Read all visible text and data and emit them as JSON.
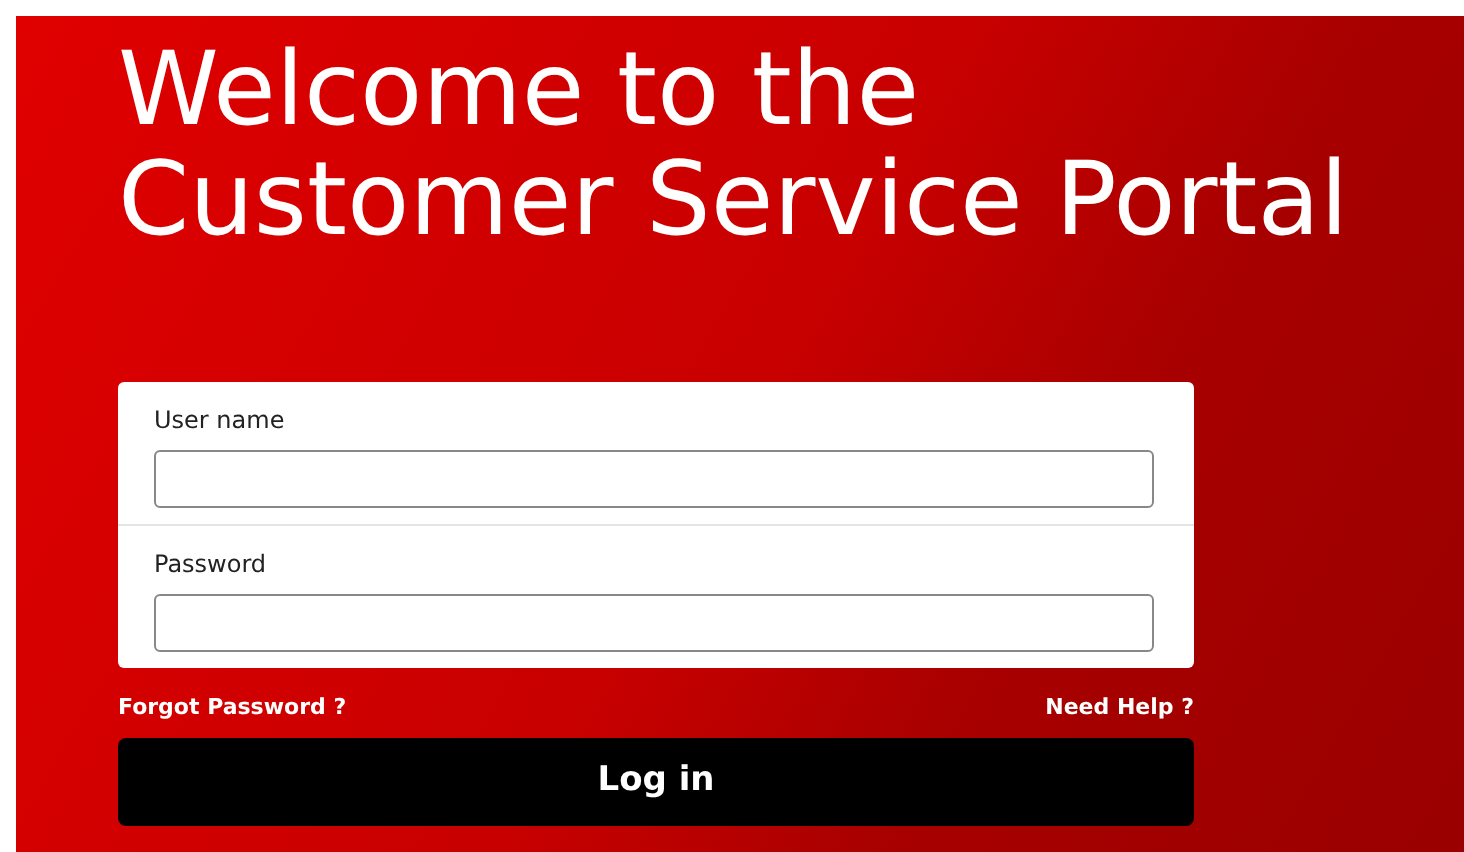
{
  "heading": {
    "lines": [
      "Welcome to the",
      "Customer Service Portal"
    ]
  },
  "form": {
    "fields": [
      {
        "label": "User name"
      },
      {
        "label": "Password"
      }
    ],
    "links": [
      "Forgot Password ?",
      "Need Help ?"
    ],
    "submit": "Log in"
  }
}
